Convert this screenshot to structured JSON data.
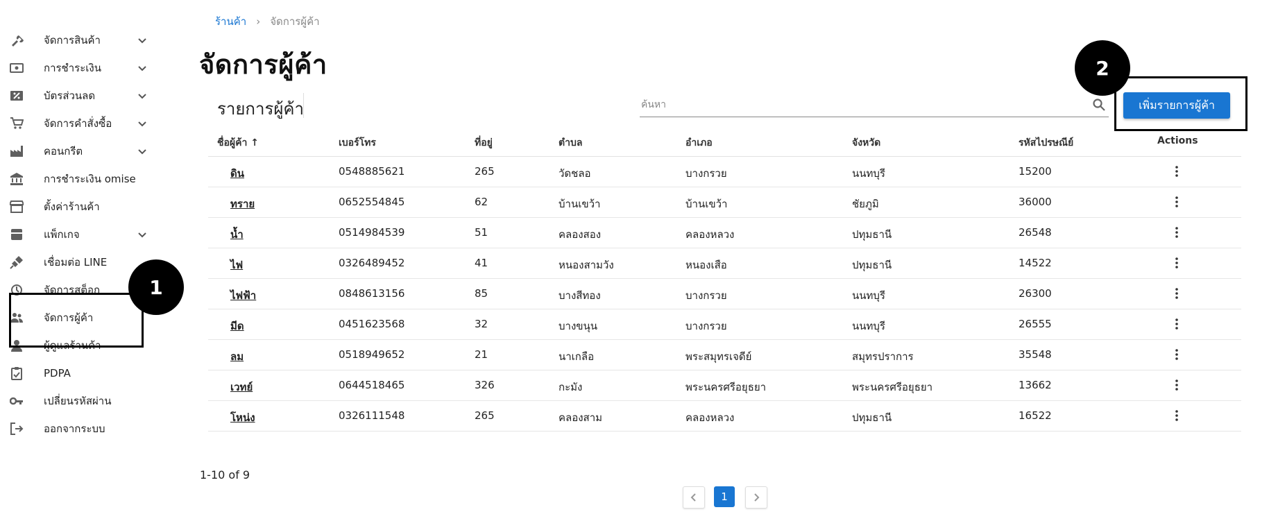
{
  "sidebar": {
    "items": [
      {
        "label": "จัดการสินค้า",
        "icon": "tools-icon",
        "has_chevron": true
      },
      {
        "label": "การชำระเงิน",
        "icon": "payment-icon",
        "has_chevron": true
      },
      {
        "label": "บัตรส่วนลด",
        "icon": "discount-icon",
        "has_chevron": true
      },
      {
        "label": "จัดการคำสั่งซื้อ",
        "icon": "cart-icon",
        "has_chevron": true
      },
      {
        "label": "คอนกรีต",
        "icon": "factory-icon",
        "has_chevron": true
      },
      {
        "label": "การชำระเงิน omise",
        "icon": "bank-icon",
        "has_chevron": false
      },
      {
        "label": "ตั้งค่าร้านค้า",
        "icon": "store-icon",
        "has_chevron": false
      },
      {
        "label": "แพ็กเกจ",
        "icon": "package-icon",
        "has_chevron": true
      },
      {
        "label": "เชื่อมต่อ LINE",
        "icon": "plug-icon",
        "has_chevron": false
      },
      {
        "label": "จัดการสต็อก",
        "icon": "stock-icon",
        "has_chevron": false
      },
      {
        "label": "จัดการผู้ค้า",
        "icon": "people-icon",
        "has_chevron": false
      },
      {
        "label": "ผู้ดูแลร้านค้า",
        "icon": "person-icon",
        "has_chevron": false
      },
      {
        "label": "PDPA",
        "icon": "clipboard-icon",
        "has_chevron": false
      },
      {
        "label": "เปลี่ยนรหัสผ่าน",
        "icon": "key-icon",
        "has_chevron": false
      },
      {
        "label": "ออกจากระบบ",
        "icon": "logout-icon",
        "has_chevron": false
      }
    ]
  },
  "breadcrumb": {
    "home": "ร้านค้า",
    "separator": "›",
    "current": "จัดการผู้ค้า"
  },
  "page_title": "จัดการผู้ค้า",
  "card": {
    "title": "รายการผู้ค้า",
    "search_placeholder": "ค้นหา",
    "add_button": "เพิ่มรายการผู้ค้า"
  },
  "annotations": {
    "one": "1",
    "two": "2"
  },
  "table": {
    "headers": [
      "ชื่อผู้ค้า ↑",
      "เบอร์โทร",
      "ที่อยู่",
      "ตำบล",
      "อำเภอ",
      "จังหวัด",
      "รหัสไปรษณีย์",
      "Actions"
    ],
    "rows": [
      [
        "ดิน",
        "0548885621",
        "265",
        "วัดชลอ",
        "บางกรวย",
        "นนทบุรี",
        "15200"
      ],
      [
        "ทราย",
        "0652554845",
        "62",
        "บ้านเขว้า",
        "บ้านเขว้า",
        "ชัยภูมิ",
        "36000"
      ],
      [
        "น้ำ",
        "0514984539",
        "51",
        "คลองสอง",
        "คลองหลวง",
        "ปทุมธานี",
        "26548"
      ],
      [
        "ไฟ",
        "0326489452",
        "41",
        "หนองสามวัง",
        "หนองเสือ",
        "ปทุมธานี",
        "14522"
      ],
      [
        "ไฟฟ้า",
        "0848613156",
        "85",
        "บางสีทอง",
        "บางกรวย",
        "นนทบุรี",
        "26300"
      ],
      [
        "มีด",
        "0451623568",
        "32",
        "บางขนุน",
        "บางกรวย",
        "นนทบุรี",
        "26555"
      ],
      [
        "ลม",
        "0518949652",
        "21",
        "นาเกลือ",
        "พระสมุทรเจดีย์",
        "สมุทรปราการ",
        "35548"
      ],
      [
        "เวทย์",
        "0644518465",
        "326",
        "กะมัง",
        "พระนครศรีอยุธยา",
        "พระนครศรีอยุธยา",
        "13662"
      ],
      [
        "โหน่ง",
        "0326111548",
        "265",
        "คลองสาม",
        "คลองหลวง",
        "ปทุมธานี",
        "16522"
      ]
    ]
  },
  "pagination": {
    "range_text": "1-10 of 9",
    "current_page": "1"
  },
  "colors": {
    "primary": "#1976d2",
    "annotation": "#000000"
  }
}
